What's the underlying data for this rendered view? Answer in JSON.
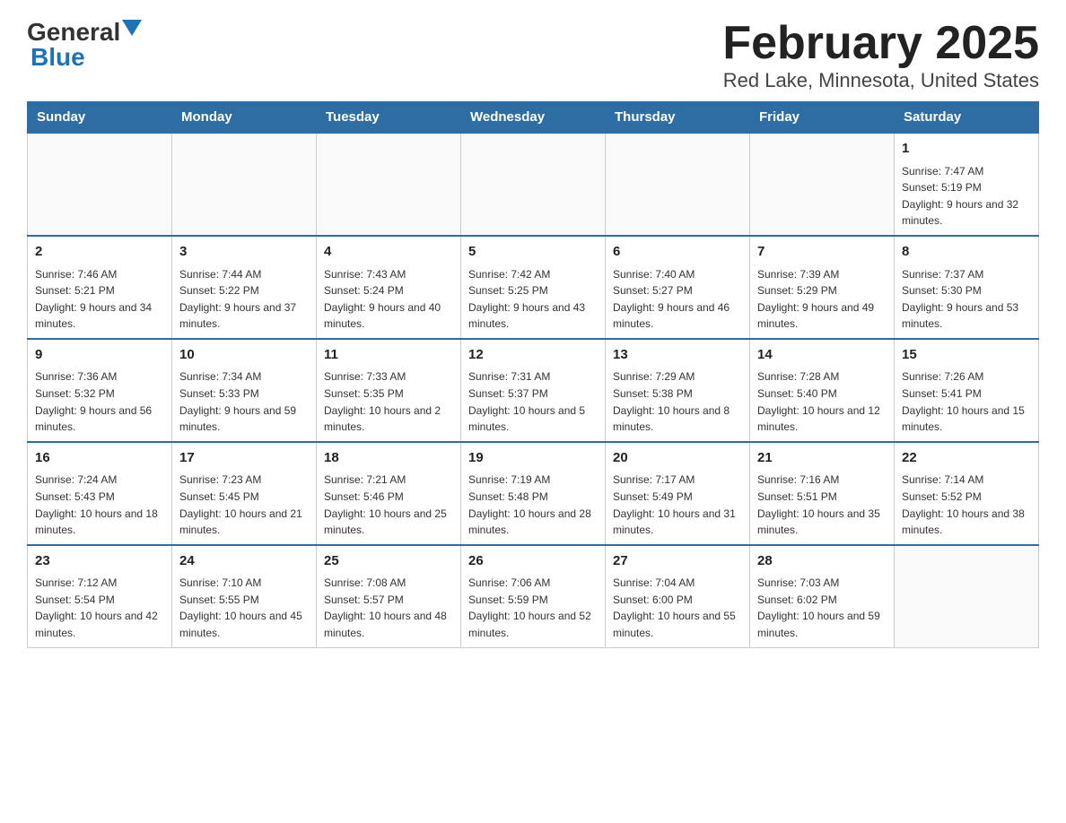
{
  "logo": {
    "general": "General",
    "blue": "Blue"
  },
  "title": "February 2025",
  "subtitle": "Red Lake, Minnesota, United States",
  "weekdays": [
    "Sunday",
    "Monday",
    "Tuesday",
    "Wednesday",
    "Thursday",
    "Friday",
    "Saturday"
  ],
  "weeks": [
    [
      {
        "day": "",
        "info": ""
      },
      {
        "day": "",
        "info": ""
      },
      {
        "day": "",
        "info": ""
      },
      {
        "day": "",
        "info": ""
      },
      {
        "day": "",
        "info": ""
      },
      {
        "day": "",
        "info": ""
      },
      {
        "day": "1",
        "info": "Sunrise: 7:47 AM\nSunset: 5:19 PM\nDaylight: 9 hours and 32 minutes."
      }
    ],
    [
      {
        "day": "2",
        "info": "Sunrise: 7:46 AM\nSunset: 5:21 PM\nDaylight: 9 hours and 34 minutes."
      },
      {
        "day": "3",
        "info": "Sunrise: 7:44 AM\nSunset: 5:22 PM\nDaylight: 9 hours and 37 minutes."
      },
      {
        "day": "4",
        "info": "Sunrise: 7:43 AM\nSunset: 5:24 PM\nDaylight: 9 hours and 40 minutes."
      },
      {
        "day": "5",
        "info": "Sunrise: 7:42 AM\nSunset: 5:25 PM\nDaylight: 9 hours and 43 minutes."
      },
      {
        "day": "6",
        "info": "Sunrise: 7:40 AM\nSunset: 5:27 PM\nDaylight: 9 hours and 46 minutes."
      },
      {
        "day": "7",
        "info": "Sunrise: 7:39 AM\nSunset: 5:29 PM\nDaylight: 9 hours and 49 minutes."
      },
      {
        "day": "8",
        "info": "Sunrise: 7:37 AM\nSunset: 5:30 PM\nDaylight: 9 hours and 53 minutes."
      }
    ],
    [
      {
        "day": "9",
        "info": "Sunrise: 7:36 AM\nSunset: 5:32 PM\nDaylight: 9 hours and 56 minutes."
      },
      {
        "day": "10",
        "info": "Sunrise: 7:34 AM\nSunset: 5:33 PM\nDaylight: 9 hours and 59 minutes."
      },
      {
        "day": "11",
        "info": "Sunrise: 7:33 AM\nSunset: 5:35 PM\nDaylight: 10 hours and 2 minutes."
      },
      {
        "day": "12",
        "info": "Sunrise: 7:31 AM\nSunset: 5:37 PM\nDaylight: 10 hours and 5 minutes."
      },
      {
        "day": "13",
        "info": "Sunrise: 7:29 AM\nSunset: 5:38 PM\nDaylight: 10 hours and 8 minutes."
      },
      {
        "day": "14",
        "info": "Sunrise: 7:28 AM\nSunset: 5:40 PM\nDaylight: 10 hours and 12 minutes."
      },
      {
        "day": "15",
        "info": "Sunrise: 7:26 AM\nSunset: 5:41 PM\nDaylight: 10 hours and 15 minutes."
      }
    ],
    [
      {
        "day": "16",
        "info": "Sunrise: 7:24 AM\nSunset: 5:43 PM\nDaylight: 10 hours and 18 minutes."
      },
      {
        "day": "17",
        "info": "Sunrise: 7:23 AM\nSunset: 5:45 PM\nDaylight: 10 hours and 21 minutes."
      },
      {
        "day": "18",
        "info": "Sunrise: 7:21 AM\nSunset: 5:46 PM\nDaylight: 10 hours and 25 minutes."
      },
      {
        "day": "19",
        "info": "Sunrise: 7:19 AM\nSunset: 5:48 PM\nDaylight: 10 hours and 28 minutes."
      },
      {
        "day": "20",
        "info": "Sunrise: 7:17 AM\nSunset: 5:49 PM\nDaylight: 10 hours and 31 minutes."
      },
      {
        "day": "21",
        "info": "Sunrise: 7:16 AM\nSunset: 5:51 PM\nDaylight: 10 hours and 35 minutes."
      },
      {
        "day": "22",
        "info": "Sunrise: 7:14 AM\nSunset: 5:52 PM\nDaylight: 10 hours and 38 minutes."
      }
    ],
    [
      {
        "day": "23",
        "info": "Sunrise: 7:12 AM\nSunset: 5:54 PM\nDaylight: 10 hours and 42 minutes."
      },
      {
        "day": "24",
        "info": "Sunrise: 7:10 AM\nSunset: 5:55 PM\nDaylight: 10 hours and 45 minutes."
      },
      {
        "day": "25",
        "info": "Sunrise: 7:08 AM\nSunset: 5:57 PM\nDaylight: 10 hours and 48 minutes."
      },
      {
        "day": "26",
        "info": "Sunrise: 7:06 AM\nSunset: 5:59 PM\nDaylight: 10 hours and 52 minutes."
      },
      {
        "day": "27",
        "info": "Sunrise: 7:04 AM\nSunset: 6:00 PM\nDaylight: 10 hours and 55 minutes."
      },
      {
        "day": "28",
        "info": "Sunrise: 7:03 AM\nSunset: 6:02 PM\nDaylight: 10 hours and 59 minutes."
      },
      {
        "day": "",
        "info": ""
      }
    ]
  ]
}
